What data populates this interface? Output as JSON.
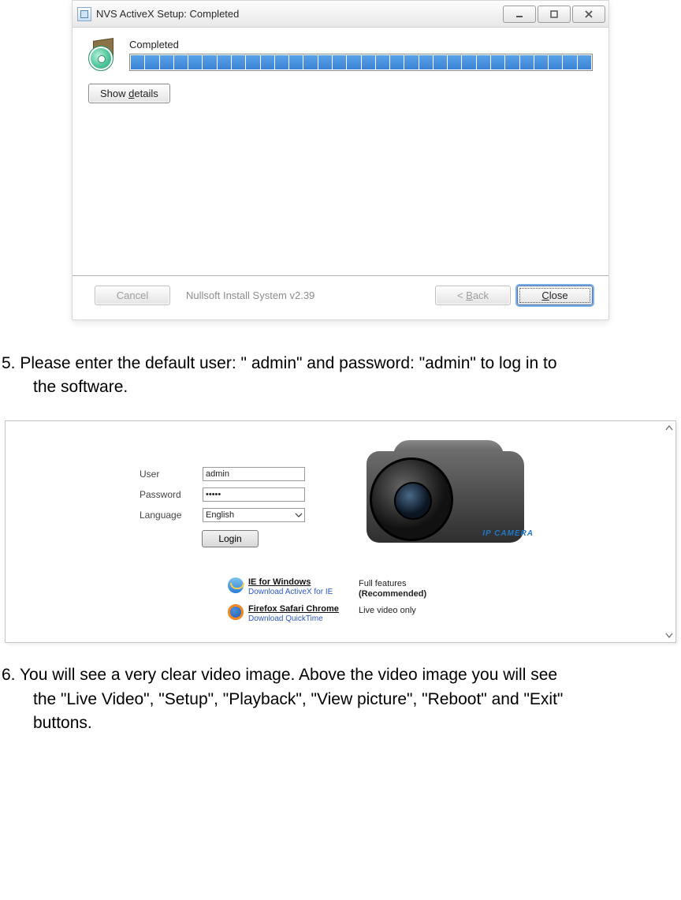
{
  "installer": {
    "title": "NVS ActiveX Setup: Completed",
    "completed_label": "Completed",
    "show_details": "Show details",
    "show_details_underline_char": "d",
    "branding": "Nullsoft Install System v2.39",
    "cancel": "Cancel",
    "back": "< Back",
    "back_underline_char": "B",
    "close": "Close",
    "close_underline_char": "C",
    "progress_segments": 32
  },
  "step5": {
    "line1": "5. Please enter the default user: \" admin\" and password: \"admin\" to log in to",
    "line2": "the software."
  },
  "login": {
    "user_label": "User",
    "user_value": "admin",
    "password_label": "Password",
    "password_value": "•••••",
    "language_label": "Language",
    "language_value": "English",
    "login_button": "Login",
    "camera_brand": "IP CAMERA",
    "ie_title": "IE for Windows",
    "ie_sub": "Download ActiveX for IE",
    "ie_desc1": "Full features",
    "ie_desc2": "(Recommended)",
    "ff_title": "Firefox Safari Chrome",
    "ff_sub": "Download QuickTime",
    "ff_desc": "Live video only"
  },
  "step6": {
    "line1": "6.  You will see a very clear video image.    Above the video image you will see",
    "line2": "the \"Live Video\", \"Setup\", \"Playback\", \"View picture\", \"Reboot\" and \"Exit\"",
    "line3": "buttons."
  }
}
